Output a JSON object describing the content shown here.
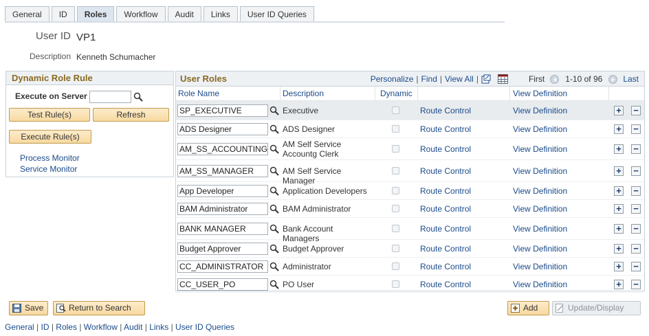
{
  "tabs": [
    "General",
    "ID",
    "Roles",
    "Workflow",
    "Audit",
    "Links",
    "User ID Queries"
  ],
  "active_tab": "Roles",
  "header": {
    "user_id_label": "User ID",
    "user_id_value": "VP1",
    "description_label": "Description",
    "description_value": "Kenneth Schumacher"
  },
  "dynamic_role": {
    "title": "Dynamic Role Rule",
    "execute_on_server_label": "Execute on Server",
    "test_rules_button": "Test Rule(s)",
    "refresh_button": "Refresh",
    "execute_rules_button": "Execute Rule(s)",
    "process_monitor_link": "Process Monitor",
    "service_monitor_link": "Service Monitor"
  },
  "grid": {
    "title": "User Roles",
    "personalize": "Personalize",
    "find": "Find",
    "view_all": "View All",
    "first": "First",
    "range": "1-10 of 96",
    "last": "Last",
    "columns": {
      "role_name": "Role Name",
      "description": "Description",
      "dynamic": "Dynamic",
      "view_definition": "View Definition"
    },
    "rows": [
      {
        "role_name": "SP_EXECUTIVE",
        "description": "Executive",
        "route": "Route Control",
        "view": "View Definition"
      },
      {
        "role_name": "ADS Designer",
        "description": "ADS Designer",
        "route": "Route Control",
        "view": "View Definition"
      },
      {
        "role_name": "AM_SS_ACCOUNTING_",
        "description": "AM Self Service Accountg Clerk",
        "route": "Route Control",
        "view": "View Definition"
      },
      {
        "role_name": "AM_SS_MANAGER",
        "description": "AM Self Service Manager",
        "route": "Route Control",
        "view": "View Definition"
      },
      {
        "role_name": "App Developer",
        "description": "Application Developers",
        "route": "Route Control",
        "view": "View Definition"
      },
      {
        "role_name": "BAM Administrator",
        "description": "BAM Administrator",
        "route": "Route Control",
        "view": "View Definition"
      },
      {
        "role_name": "BANK MANAGER",
        "description": "Bank Account Managers",
        "route": "Route Control",
        "view": "View Definition"
      },
      {
        "role_name": "Budget Approver",
        "description": "Budget Approver",
        "route": "Route Control",
        "view": "View Definition"
      },
      {
        "role_name": "CC_ADMINISTRATOR",
        "description": "Administrator",
        "route": "Route Control",
        "view": "View Definition"
      },
      {
        "role_name": "CC_USER_PO",
        "description": "PO User",
        "route": "Route Control",
        "view": "View Definition"
      }
    ]
  },
  "bottom": {
    "save": "Save",
    "return_to_search": "Return to Search",
    "add": "Add",
    "update_display": "Update/Display"
  },
  "footer_links": [
    "General",
    "ID",
    "Roles",
    "Workflow",
    "Audit",
    "Links",
    "User ID Queries"
  ],
  "colors": {
    "link": "#1a4a8a",
    "section_title": "#8a6a20",
    "button": "#f7d9a0"
  }
}
